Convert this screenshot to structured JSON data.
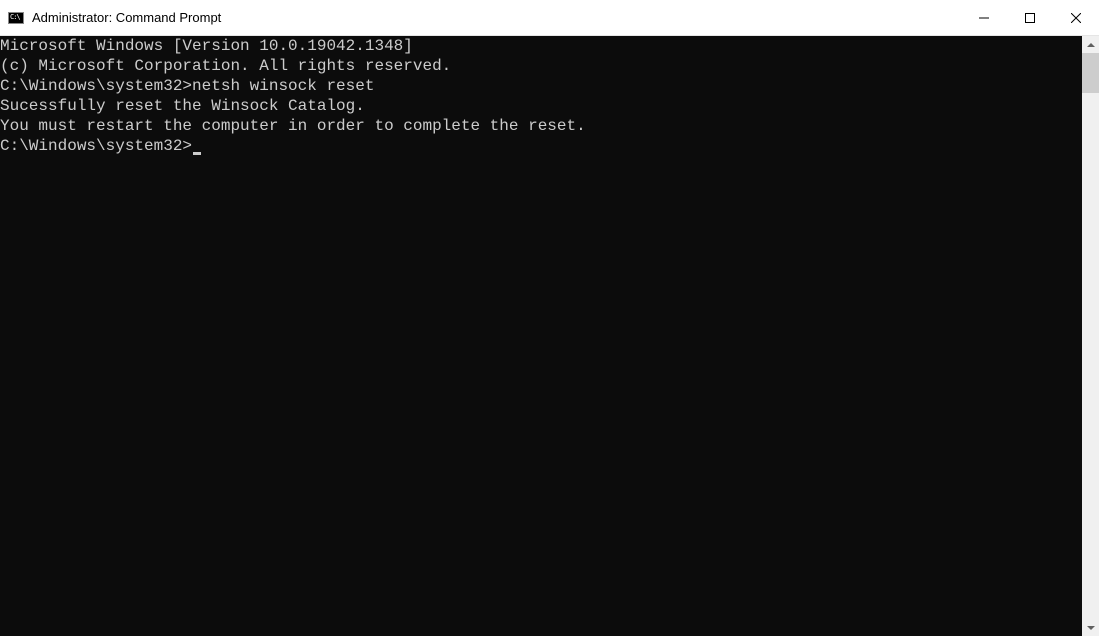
{
  "titlebar": {
    "title": "Administrator: Command Prompt"
  },
  "console": {
    "line1": "Microsoft Windows [Version 10.0.19042.1348]",
    "line2": "(c) Microsoft Corporation. All rights reserved.",
    "blank1": "",
    "prompt1_path": "C:\\Windows\\system32>",
    "prompt1_cmd": "netsh winsock reset",
    "blank2": "",
    "output1": "Sucessfully reset the Winsock Catalog.",
    "output2": "You must restart the computer in order to complete the reset.",
    "blank3": "",
    "blank4": "",
    "prompt2_path": "C:\\Windows\\system32>"
  }
}
